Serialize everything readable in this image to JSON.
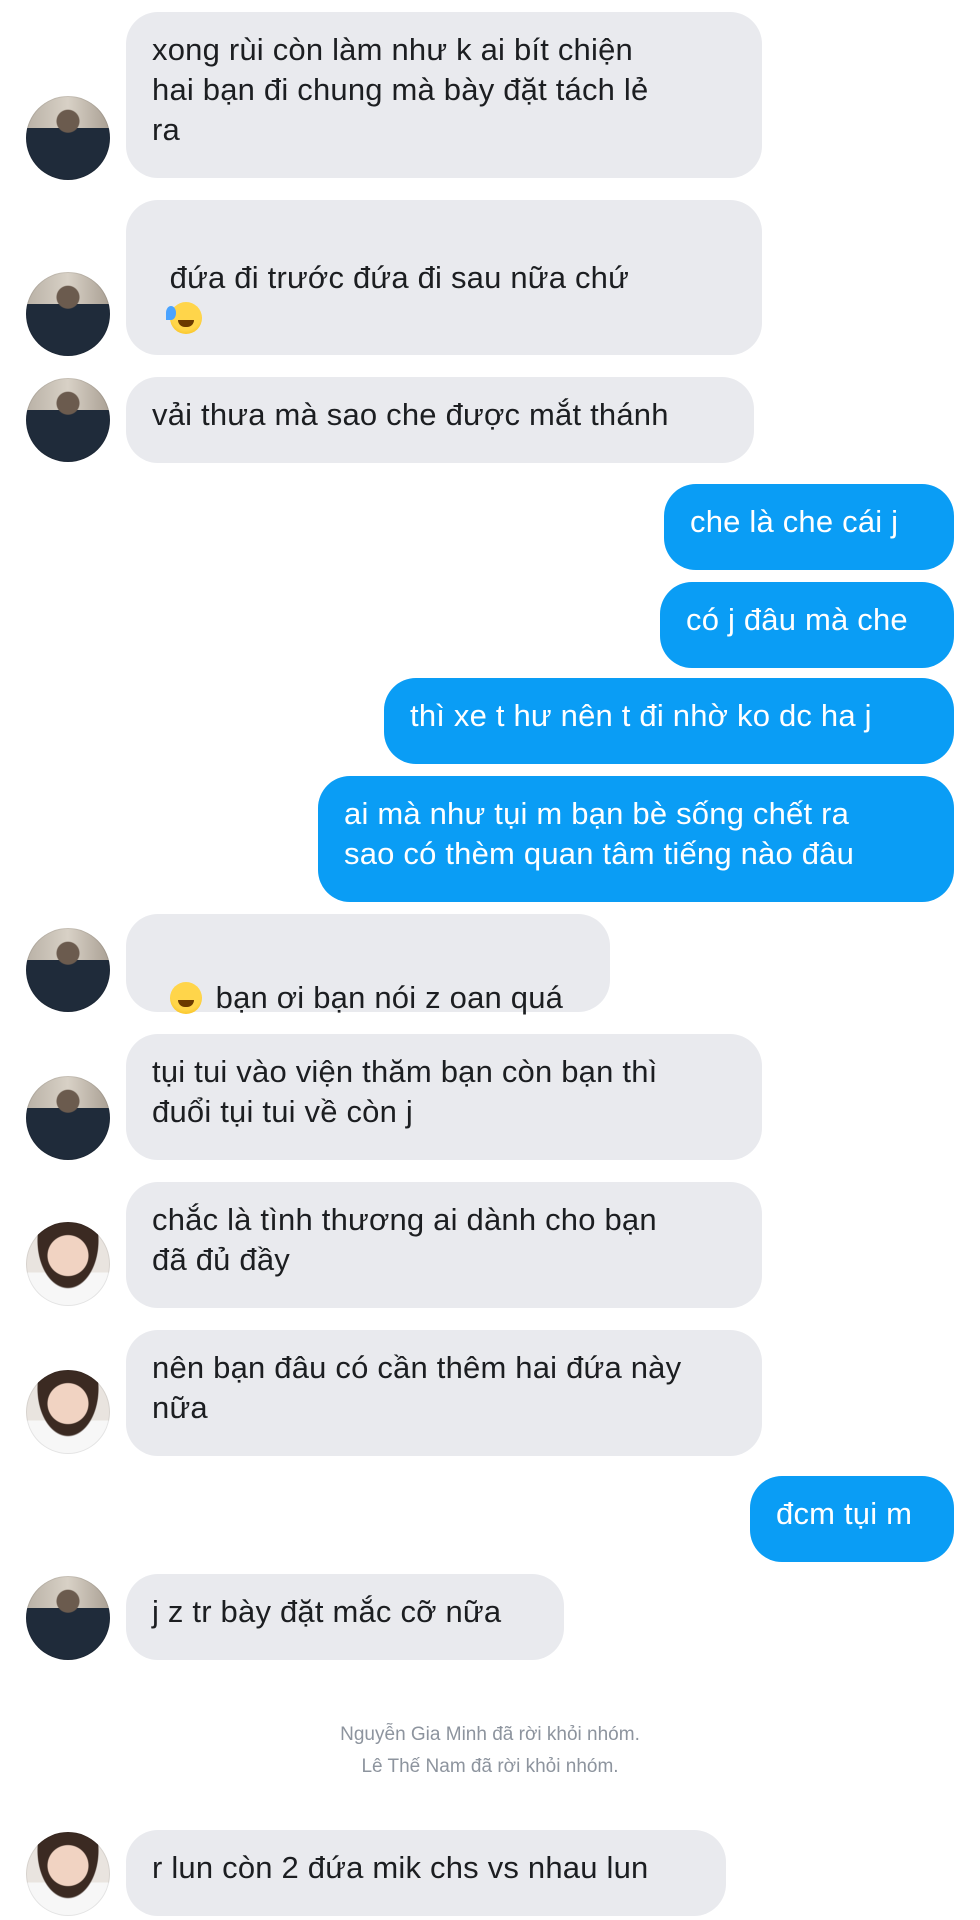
{
  "colors": {
    "incoming_bubble": "#e9eaee",
    "outgoing_bubble": "#0a9df5"
  },
  "messages": [
    {
      "side": "in",
      "avatar": "a",
      "text": "xong rùi còn làm như k ai bít chiện\nhai bạn đi chung mà bày đặt tách lẻ\nra"
    },
    {
      "side": "in",
      "avatar": "a",
      "text": "đứa đi trước đứa đi sau nữa chứ",
      "emoji": [
        "rofl-emoji",
        "rofl-emoji",
        "rofl-emoji"
      ]
    },
    {
      "side": "in",
      "avatar": "a",
      "text": "vải thưa mà sao che được mắt thánh"
    },
    {
      "side": "out",
      "text": "che là che cái j"
    },
    {
      "side": "out",
      "text": "có j đâu mà che"
    },
    {
      "side": "out",
      "text": "thì xe t hư nên t đi nhờ ko dc ha j"
    },
    {
      "side": "out",
      "text": "ai mà như tụi m bạn bè sống chết ra\nsao có thèm quan tâm tiếng nào đâu"
    },
    {
      "side": "in",
      "avatar": "a",
      "text": "bạn ơi bạn nói z oan quá",
      "emoji_before": "grimace-emoji"
    },
    {
      "side": "in",
      "avatar": "a",
      "text": "tụi tui vào viện thăm bạn còn bạn thì\nđuổi tụi tui về còn j"
    },
    {
      "side": "in",
      "avatar": "b",
      "text": "chắc là tình thương ai dành cho bạn\nđã đủ đầy"
    },
    {
      "side": "in",
      "avatar": "b",
      "text": "nên bạn đâu có cần thêm hai đứa này\nnữa"
    },
    {
      "side": "out",
      "text": "đcm tụi m"
    },
    {
      "side": "in",
      "avatar": "a",
      "text": "j z tr bày đặt mắc cỡ nữa"
    },
    {
      "side": "in",
      "avatar": "b",
      "text": "r lun còn 2 đứa mik chs vs nhau lun"
    }
  ],
  "system_notices": [
    "Nguyễn Gia Minh đã rời khỏi nhóm.",
    "Lê Thế Nam đã rời khỏi nhóm."
  ]
}
